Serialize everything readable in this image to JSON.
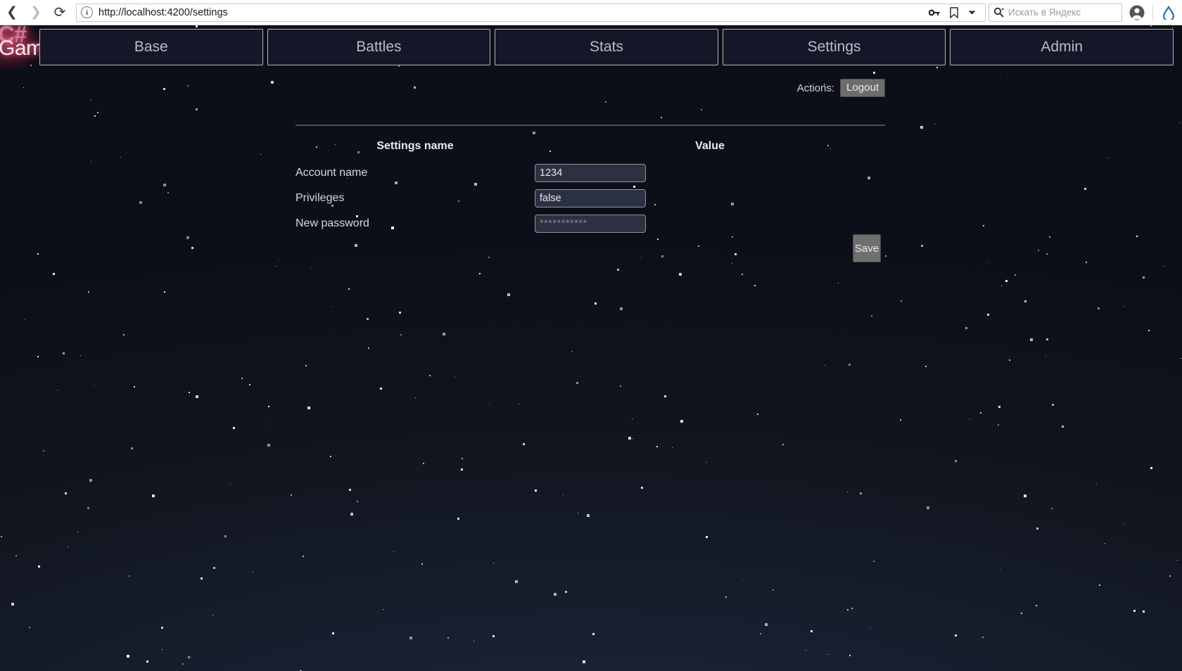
{
  "browser": {
    "back_icon": "back-arrow-icon",
    "forward_icon": "forward-arrow-icon",
    "reload_icon": "reload-icon",
    "url": "http://localhost:4200/settings",
    "info_icon_label": "i",
    "key_icon": "key-icon",
    "bookmark_icon": "bookmark-icon",
    "dropdown_icon": "chevron-down-icon",
    "search_icon": "search-magnifier-icon",
    "search_placeholder": "Искать в Яндекс",
    "profile_icon": "user-avatar-icon",
    "assistant_icon": "alice-assistant-icon"
  },
  "app": {
    "logo_mark": "C#",
    "logo_word": "Game",
    "nav_tabs": [
      {
        "label": "Base",
        "name": "tab-base"
      },
      {
        "label": "Battles",
        "name": "tab-battles"
      },
      {
        "label": "Stats",
        "name": "tab-stats"
      },
      {
        "label": "Settings",
        "name": "tab-settings"
      },
      {
        "label": "Admin",
        "name": "tab-admin"
      }
    ],
    "actions": {
      "label": "Actions:",
      "logout_label": "Logout"
    },
    "table": {
      "header_name": "Settings name",
      "header_value": "Value",
      "rows": [
        {
          "label": "Account name",
          "value": "1234",
          "placeholder": "",
          "type": "text"
        },
        {
          "label": "Privileges",
          "value": "false",
          "placeholder": "",
          "type": "text"
        },
        {
          "label": "New password",
          "value": "",
          "placeholder": "***********",
          "type": "text"
        }
      ]
    },
    "save_label": "Save",
    "colors": {
      "background_dark": "#0c0f17",
      "background_light": "#1d2838",
      "tab_fill": "#151728",
      "tab_border": "#b6b6b6",
      "text": "#b9bcc6",
      "input_fill": "#2c3142",
      "input_border": "#8c93a3",
      "button_fill": "#6f6f6f",
      "divider": "#4c5360",
      "logo_glow": "#ff3c6e"
    }
  }
}
